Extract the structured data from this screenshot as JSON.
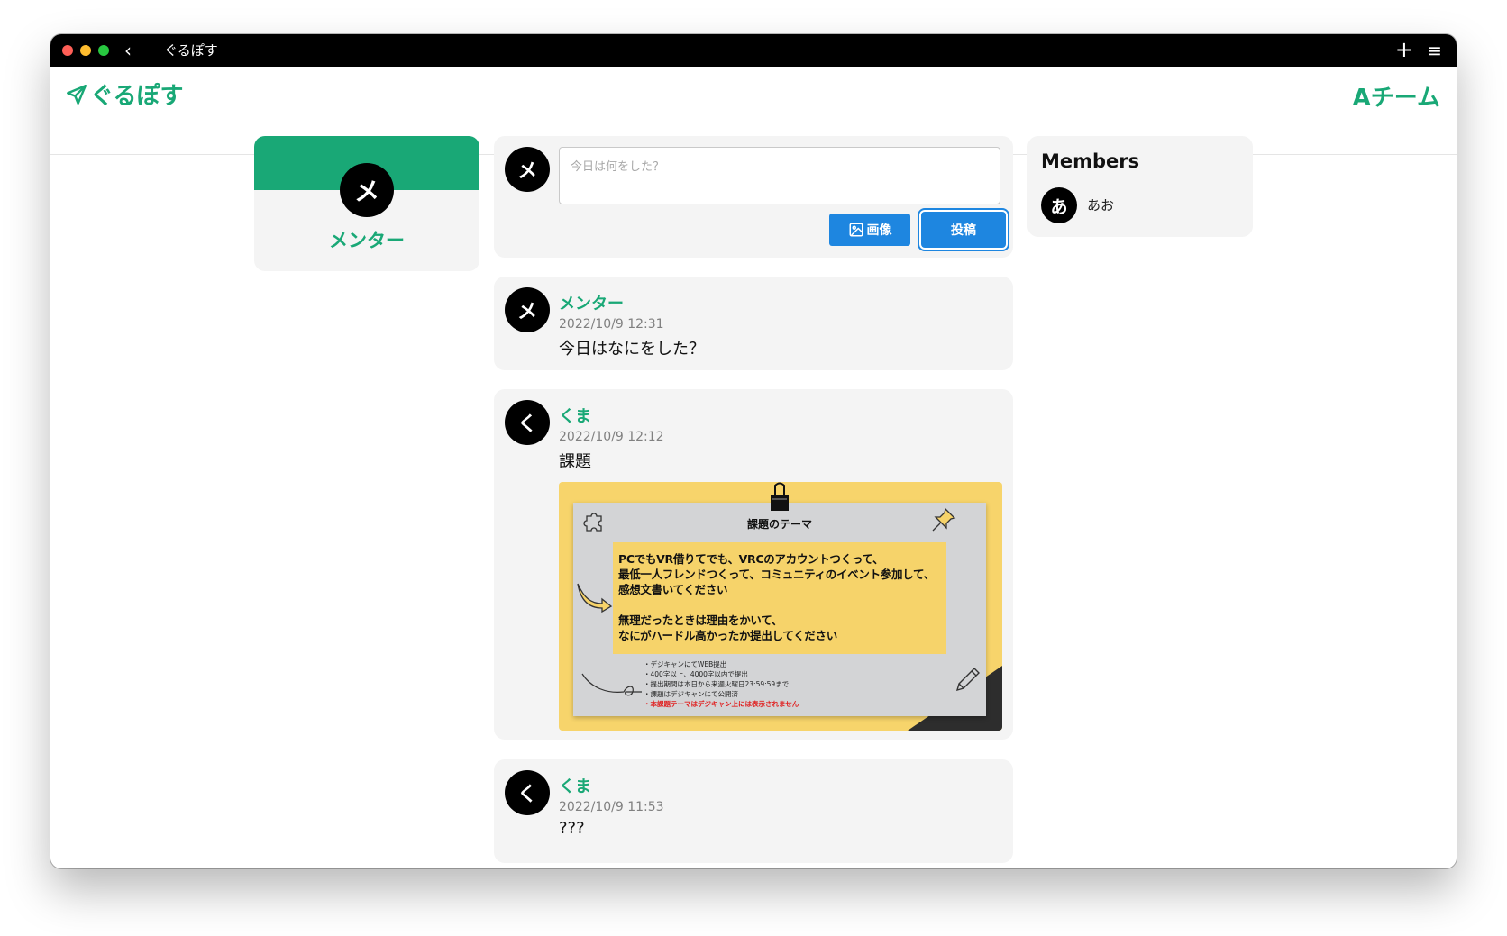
{
  "window": {
    "title": "ぐるぽす",
    "back_glyph": "‹",
    "plus_glyph": "+",
    "menu_glyph": "≡"
  },
  "header": {
    "brand": "ぐるぽす",
    "team": "Aチーム"
  },
  "profile": {
    "avatar_initial": "メ",
    "name": "メンター"
  },
  "composer": {
    "avatar_initial": "メ",
    "placeholder": "今日は何をした？",
    "image_button_label": "画像",
    "post_button_label": "投稿"
  },
  "members": {
    "title": "Members",
    "list": [
      {
        "initial": "あ",
        "name": "あお"
      }
    ]
  },
  "posts": [
    {
      "avatar_initial": "メ",
      "author": "メンター",
      "time": "2022/10/9 12:31",
      "body": "今日はなにをした？"
    },
    {
      "avatar_initial": "く",
      "author": "くま",
      "time": "2022/10/9 12:12",
      "body": "課題",
      "attachment": {
        "title": "課題のテーマ",
        "main_lines": [
          "PCでもVR借りてでも、VRCのアカウントつくって、",
          "最低一人フレンドつくって、コミュニティのイベント参加して、",
          "感想文書いてください",
          "無理だったときは理由をかいて、",
          "なにがハードル高かったか提出してください"
        ],
        "notes": [
          "・デジキャンにてWEB提出",
          "・400字以上、4000字以内で提出",
          "・提出期間は本日から来週火曜日23:59:59まで",
          "・課題はデジキャンにて公開済"
        ],
        "warning": "・本課題テーマはデジキャン上には表示されません"
      }
    },
    {
      "avatar_initial": "く",
      "author": "くま",
      "time": "2022/10/9 11:53",
      "body": "???"
    }
  ],
  "colors": {
    "brand_green": "#19a876",
    "button_blue": "#1e86e0",
    "card_bg": "#f4f4f4",
    "attachment_yellow": "#f7d46b"
  }
}
